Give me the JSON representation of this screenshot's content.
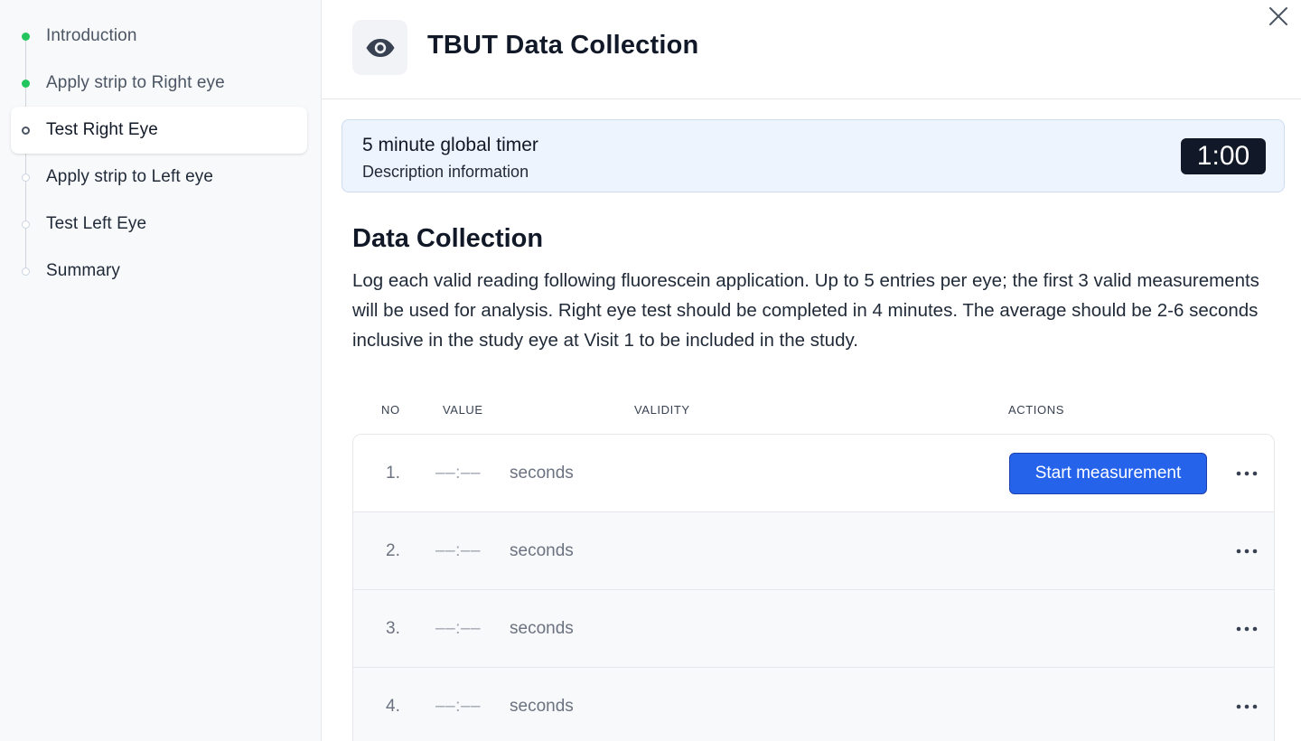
{
  "sidebar": {
    "steps": [
      {
        "label": "Introduction",
        "status": "done"
      },
      {
        "label": "Apply strip to Right eye",
        "status": "done"
      },
      {
        "label": "Test Right Eye",
        "status": "current"
      },
      {
        "label": "Apply strip to Left eye",
        "status": "todo"
      },
      {
        "label": "Test Left Eye",
        "status": "todo"
      },
      {
        "label": "Summary",
        "status": "todo"
      }
    ]
  },
  "header": {
    "title": "TBUT Data Collection",
    "icon": "eye-icon",
    "close_icon": "close-icon"
  },
  "timer_banner": {
    "title": "5 minute global timer",
    "description": "Description information",
    "time": "1:00"
  },
  "data_collection": {
    "title": "Data Collection",
    "description": "Log each valid reading following fluorescein application. Up to 5 entries per eye; the first 3 valid measurements will be used for analysis. Right eye test should be completed in 4 minutes. The average should be 2-6 seconds inclusive in the study eye at Visit 1 to be included in the study."
  },
  "table": {
    "headers": {
      "no": "NO",
      "value": "VALUE",
      "validity": "VALIDITY",
      "actions": "ACTIONS"
    },
    "rows": [
      {
        "no": "1.",
        "value": "––:––",
        "unit": "seconds",
        "action": "Start measurement"
      },
      {
        "no": "2.",
        "value": "––:––",
        "unit": "seconds"
      },
      {
        "no": "3.",
        "value": "––:––",
        "unit": "seconds"
      },
      {
        "no": "4.",
        "value": "––:––",
        "unit": "seconds"
      }
    ]
  },
  "colors": {
    "accent": "#2563eb",
    "done": "#22c55e",
    "timer_bg": "#111827",
    "banner_bg": "#eef4fd"
  }
}
